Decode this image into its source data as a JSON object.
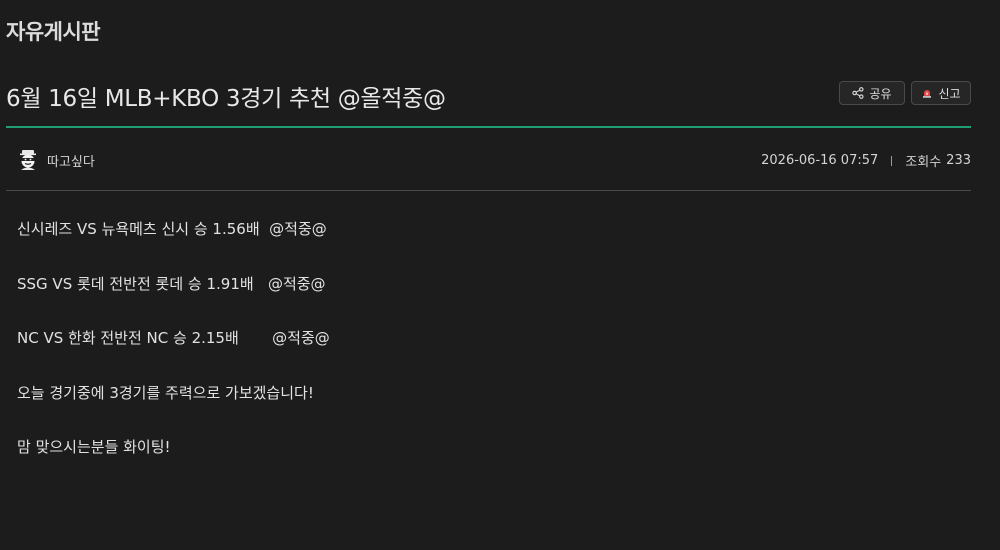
{
  "board": {
    "title": "자유게시판"
  },
  "post": {
    "title": "6월 16일 MLB+KBO 3경기 추천 @올적중@",
    "share_label": "공유",
    "report_label": "신고",
    "author": "따고싶다",
    "datetime": "2026-06-16 07:57",
    "views_label": "조회수",
    "views": "233",
    "lines": [
      "신시레즈 VS 뉴욕메츠 신시 승 1.56배  @적중@",
      "SSG VS 롯데 전반전 롯데 승 1.91배   @적중@",
      "NC VS 한화 전반전 NC 승 2.15배       @적중@",
      "오늘 경기중에 3경기를 주력으로 가보겠습니다!",
      "맘 맞으시는분들 화이팅!"
    ]
  },
  "icons": {
    "share": "share-icon",
    "report": "siren-icon",
    "avatar": "bandit-avatar-icon"
  },
  "colors": {
    "background": "#1c1c1c",
    "accent": "#1f9e72",
    "report": "#e04848"
  }
}
